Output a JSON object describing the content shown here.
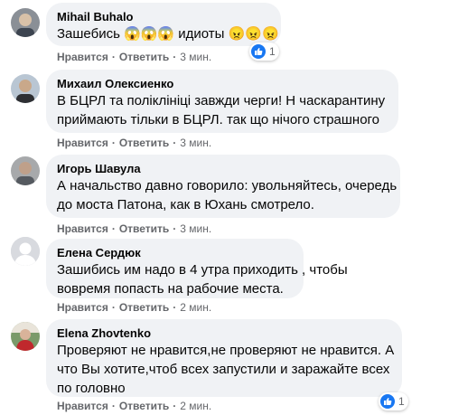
{
  "actions": {
    "like": "Нравится",
    "reply": "Ответить",
    "separator": "·"
  },
  "comments": [
    {
      "author": "Mihail Buhalo",
      "lines": [
        "Зашебись 😱😱😱 идиоты 😠😠😠"
      ],
      "time": "3 мин.",
      "reactions": "1"
    },
    {
      "author": "Михаил Олексиенко",
      "lines": [
        "В БЦРЛ та поліклініці завжди черги! Н часкарантину",
        "приймають тільки в БЦРЛ. так що нічого страшного"
      ],
      "time": "3 мин."
    },
    {
      "author": "Игорь Шавула",
      "lines": [
        "А начальство давно говорило: увольняйтесь, очередь",
        "до моста Патона, как в Юхань смотрело."
      ],
      "time": "3 мин."
    },
    {
      "author": "Елена Сердюк",
      "lines": [
        "Зашибись им надо в 4 утра приходить , чтобы",
        "вовремя попасть на рабочие места."
      ],
      "time": "2 мин."
    },
    {
      "author": "Elena Zhovtenko",
      "lines": [
        "Проверяют не нравится,не проверяют не нравится. А",
        "что Вы хотите,чтоб всех запустили и заражайте всех",
        "по головно"
      ],
      "time": "2 мин.",
      "reactions": "1"
    }
  ]
}
